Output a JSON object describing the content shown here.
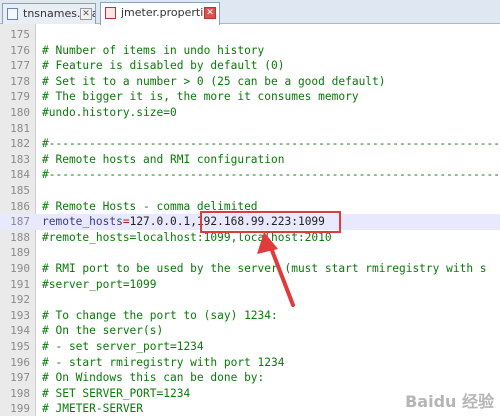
{
  "tabs": [
    {
      "label": "tnsnames.ora",
      "active": false
    },
    {
      "label": "jmeter.properties",
      "active": true
    }
  ],
  "lines": [
    {
      "n": "175",
      "text": "",
      "type": "plain"
    },
    {
      "n": "176",
      "text": "# Number of items in undo history",
      "type": "comment"
    },
    {
      "n": "177",
      "text": "# Feature is disabled by default (0)",
      "type": "comment"
    },
    {
      "n": "178",
      "text": "# Set it to a number > 0 (25 can be a good default)",
      "type": "comment"
    },
    {
      "n": "179",
      "text": "# The bigger it is, the more it consumes memory",
      "type": "comment"
    },
    {
      "n": "180",
      "text": "#undo.history.size=0",
      "type": "comment"
    },
    {
      "n": "181",
      "text": "",
      "type": "plain"
    },
    {
      "n": "182",
      "text": "#---------------------------------------------------------------------",
      "type": "comment"
    },
    {
      "n": "183",
      "text": "# Remote hosts and RMI configuration",
      "type": "comment"
    },
    {
      "n": "184",
      "text": "#---------------------------------------------------------------------",
      "type": "comment"
    },
    {
      "n": "185",
      "text": "",
      "type": "plain"
    },
    {
      "n": "186",
      "text": "# Remote Hosts - comma delimited",
      "type": "comment"
    },
    {
      "n": "187",
      "key": "remote_hosts",
      "eq": "=",
      "value": "127.0.0.1,192.168.99.223:1099",
      "type": "kv",
      "highlight": true
    },
    {
      "n": "188",
      "text": "#remote_hosts=localhost:1099,localhost:2010",
      "type": "comment"
    },
    {
      "n": "189",
      "text": "",
      "type": "plain"
    },
    {
      "n": "190",
      "text": "# RMI port to be used by the server (must start rmiregistry with s",
      "type": "comment"
    },
    {
      "n": "191",
      "text": "#server_port=1099",
      "type": "comment"
    },
    {
      "n": "192",
      "text": "",
      "type": "plain"
    },
    {
      "n": "193",
      "text": "# To change the port to (say) 1234:",
      "type": "comment"
    },
    {
      "n": "194",
      "text": "# On the server(s)",
      "type": "comment"
    },
    {
      "n": "195",
      "text": "# - set server_port=1234",
      "type": "comment"
    },
    {
      "n": "196",
      "text": "# - start rmiregistry with port 1234",
      "type": "comment"
    },
    {
      "n": "197",
      "text": "# On Windows this can be done by:",
      "type": "comment"
    },
    {
      "n": "198",
      "text": "# SET SERVER_PORT=1234",
      "type": "comment"
    },
    {
      "n": "199",
      "text": "# JMETER-SERVER",
      "type": "comment"
    }
  ],
  "watermark": "Baidu 经验",
  "colors": {
    "comment": "#0a7a0a",
    "highlight": "#e8e8ff",
    "annotation": "#e03a3a"
  }
}
